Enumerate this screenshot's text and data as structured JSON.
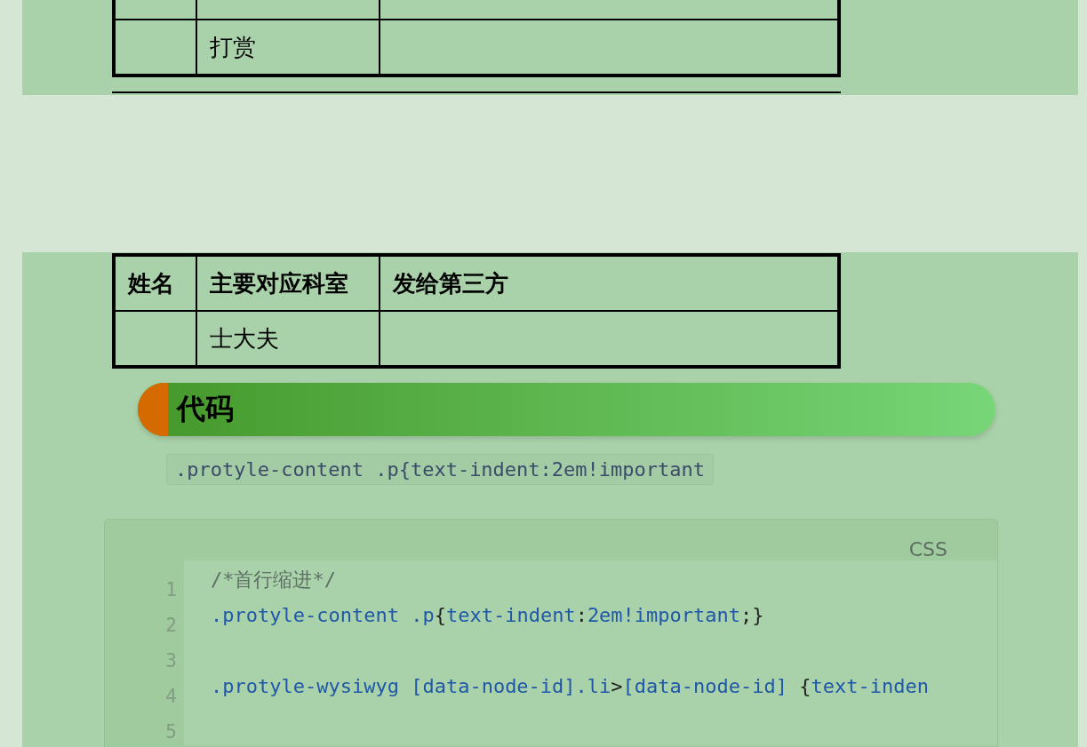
{
  "top_table": {
    "rows": [
      [
        "",
        "打赏",
        ""
      ]
    ]
  },
  "table": {
    "columns": [
      "姓名",
      "主要对应科室",
      "发给第三方"
    ],
    "rows": [
      [
        "",
        "士大夫",
        ""
      ]
    ]
  },
  "heading": "代码",
  "inline_code": ".protyle-content .p{text-indent:2em!important",
  "code_block": {
    "language": "CSS",
    "lines": [
      {
        "number": "1",
        "tokens": [
          {
            "text": "/*首行缩进*/",
            "kind": "comment"
          }
        ]
      },
      {
        "number": "2",
        "tokens": [
          {
            "text": ".protyle-content .p",
            "kind": "selector"
          },
          {
            "text": "{",
            "kind": "punct"
          },
          {
            "text": "text-indent",
            "kind": "selector"
          },
          {
            "text": ":",
            "kind": "punct"
          },
          {
            "text": "2em!important",
            "kind": "selector"
          },
          {
            "text": ";}",
            "kind": "punct"
          }
        ]
      },
      {
        "number": "3"
      },
      {
        "number": "4",
        "tokens": [
          {
            "text": ".protyle-wysiwyg [data-node-id].li",
            "kind": "selector"
          },
          {
            "text": ">",
            "kind": "punct"
          },
          {
            "text": "[data-node-id]",
            "kind": "selector"
          },
          {
            "text": " {",
            "kind": "punct"
          },
          {
            "text": "text-inden",
            "kind": "selector"
          }
        ]
      },
      {
        "number": "5"
      }
    ]
  }
}
